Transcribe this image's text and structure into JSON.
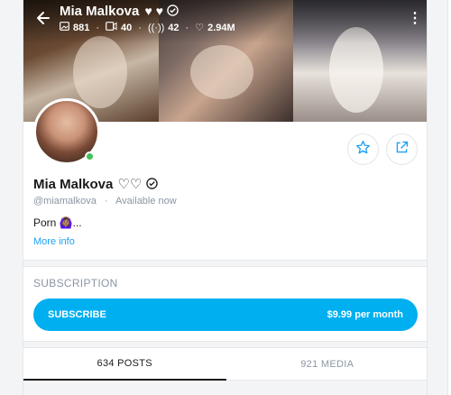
{
  "header": {
    "name": "Mia Malkova",
    "name_icons": "♥ ♥",
    "stats": [
      {
        "icon": "image-icon",
        "value": "881"
      },
      {
        "icon": "video-icon",
        "value": "40"
      },
      {
        "icon": "live-icon",
        "value": "42"
      },
      {
        "icon": "heart-icon",
        "value": "2.94M"
      }
    ]
  },
  "profile": {
    "name": "Mia Malkova",
    "handle": "@miamalkova",
    "status": "Available now",
    "bio": "Porn 🙆🏽‍♀️...",
    "more_info": "More info"
  },
  "subscription": {
    "title": "SUBSCRIPTION",
    "button_label": "SUBSCRIBE",
    "price": "$9.99 per month"
  },
  "tabs": [
    {
      "label": "634 POSTS",
      "active": true
    },
    {
      "label": "921 MEDIA",
      "active": false
    }
  ],
  "colors": {
    "accent": "#00aff0",
    "link": "#1da1f2",
    "online": "#3fc35c"
  }
}
